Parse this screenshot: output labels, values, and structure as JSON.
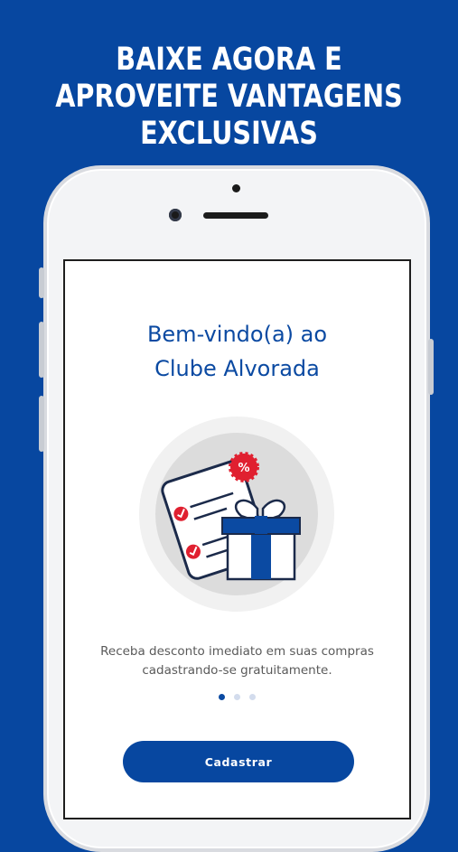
{
  "promo": {
    "headline_lines": [
      "BAIXE AGORA E",
      "APROVEITE VANTAGENS",
      "EXCLUSIVAS"
    ]
  },
  "screen": {
    "title_lines": [
      "Bem-vindo(a) ao",
      "Clube Alvorada"
    ],
    "description_lines": [
      "Receba desconto imediato em suas compras",
      "cadastrando-se gratuitamente."
    ],
    "pagination": {
      "total": 3,
      "current": 1
    },
    "cta_label": "Cadastrar",
    "illustration": {
      "icon": "gift-voucher-illustration",
      "badge_symbol": "%"
    }
  },
  "colors": {
    "background": "#0747a0",
    "primary": "#0b4aa2",
    "accent_red": "#e02030"
  }
}
